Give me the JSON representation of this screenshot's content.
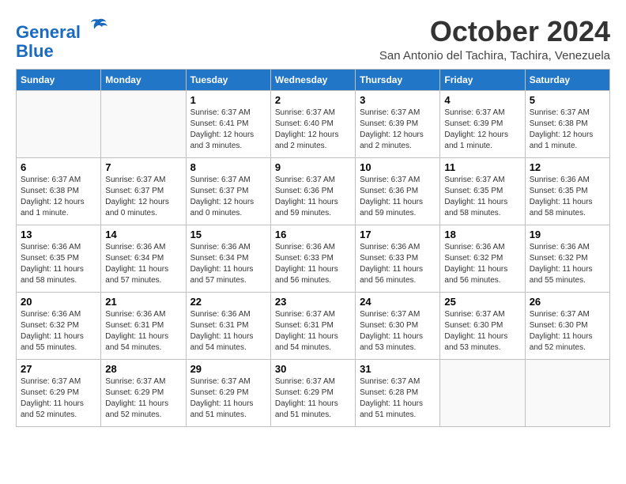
{
  "logo": {
    "line1": "General",
    "line2": "Blue"
  },
  "title": "October 2024",
  "location": "San Antonio del Tachira, Tachira, Venezuela",
  "headers": [
    "Sunday",
    "Monday",
    "Tuesday",
    "Wednesday",
    "Thursday",
    "Friday",
    "Saturday"
  ],
  "weeks": [
    [
      {
        "day": "",
        "content": "",
        "empty": true
      },
      {
        "day": "",
        "content": "",
        "empty": true
      },
      {
        "day": "1",
        "content": "Sunrise: 6:37 AM\nSunset: 6:41 PM\nDaylight: 12 hours\nand 3 minutes."
      },
      {
        "day": "2",
        "content": "Sunrise: 6:37 AM\nSunset: 6:40 PM\nDaylight: 12 hours\nand 2 minutes."
      },
      {
        "day": "3",
        "content": "Sunrise: 6:37 AM\nSunset: 6:39 PM\nDaylight: 12 hours\nand 2 minutes."
      },
      {
        "day": "4",
        "content": "Sunrise: 6:37 AM\nSunset: 6:39 PM\nDaylight: 12 hours\nand 1 minute."
      },
      {
        "day": "5",
        "content": "Sunrise: 6:37 AM\nSunset: 6:38 PM\nDaylight: 12 hours\nand 1 minute."
      }
    ],
    [
      {
        "day": "6",
        "content": "Sunrise: 6:37 AM\nSunset: 6:38 PM\nDaylight: 12 hours\nand 1 minute."
      },
      {
        "day": "7",
        "content": "Sunrise: 6:37 AM\nSunset: 6:37 PM\nDaylight: 12 hours\nand 0 minutes."
      },
      {
        "day": "8",
        "content": "Sunrise: 6:37 AM\nSunset: 6:37 PM\nDaylight: 12 hours\nand 0 minutes."
      },
      {
        "day": "9",
        "content": "Sunrise: 6:37 AM\nSunset: 6:36 PM\nDaylight: 11 hours\nand 59 minutes."
      },
      {
        "day": "10",
        "content": "Sunrise: 6:37 AM\nSunset: 6:36 PM\nDaylight: 11 hours\nand 59 minutes."
      },
      {
        "day": "11",
        "content": "Sunrise: 6:37 AM\nSunset: 6:35 PM\nDaylight: 11 hours\nand 58 minutes."
      },
      {
        "day": "12",
        "content": "Sunrise: 6:36 AM\nSunset: 6:35 PM\nDaylight: 11 hours\nand 58 minutes."
      }
    ],
    [
      {
        "day": "13",
        "content": "Sunrise: 6:36 AM\nSunset: 6:35 PM\nDaylight: 11 hours\nand 58 minutes."
      },
      {
        "day": "14",
        "content": "Sunrise: 6:36 AM\nSunset: 6:34 PM\nDaylight: 11 hours\nand 57 minutes."
      },
      {
        "day": "15",
        "content": "Sunrise: 6:36 AM\nSunset: 6:34 PM\nDaylight: 11 hours\nand 57 minutes."
      },
      {
        "day": "16",
        "content": "Sunrise: 6:36 AM\nSunset: 6:33 PM\nDaylight: 11 hours\nand 56 minutes."
      },
      {
        "day": "17",
        "content": "Sunrise: 6:36 AM\nSunset: 6:33 PM\nDaylight: 11 hours\nand 56 minutes."
      },
      {
        "day": "18",
        "content": "Sunrise: 6:36 AM\nSunset: 6:32 PM\nDaylight: 11 hours\nand 56 minutes."
      },
      {
        "day": "19",
        "content": "Sunrise: 6:36 AM\nSunset: 6:32 PM\nDaylight: 11 hours\nand 55 minutes."
      }
    ],
    [
      {
        "day": "20",
        "content": "Sunrise: 6:36 AM\nSunset: 6:32 PM\nDaylight: 11 hours\nand 55 minutes."
      },
      {
        "day": "21",
        "content": "Sunrise: 6:36 AM\nSunset: 6:31 PM\nDaylight: 11 hours\nand 54 minutes."
      },
      {
        "day": "22",
        "content": "Sunrise: 6:36 AM\nSunset: 6:31 PM\nDaylight: 11 hours\nand 54 minutes."
      },
      {
        "day": "23",
        "content": "Sunrise: 6:37 AM\nSunset: 6:31 PM\nDaylight: 11 hours\nand 54 minutes."
      },
      {
        "day": "24",
        "content": "Sunrise: 6:37 AM\nSunset: 6:30 PM\nDaylight: 11 hours\nand 53 minutes."
      },
      {
        "day": "25",
        "content": "Sunrise: 6:37 AM\nSunset: 6:30 PM\nDaylight: 11 hours\nand 53 minutes."
      },
      {
        "day": "26",
        "content": "Sunrise: 6:37 AM\nSunset: 6:30 PM\nDaylight: 11 hours\nand 52 minutes."
      }
    ],
    [
      {
        "day": "27",
        "content": "Sunrise: 6:37 AM\nSunset: 6:29 PM\nDaylight: 11 hours\nand 52 minutes."
      },
      {
        "day": "28",
        "content": "Sunrise: 6:37 AM\nSunset: 6:29 PM\nDaylight: 11 hours\nand 52 minutes."
      },
      {
        "day": "29",
        "content": "Sunrise: 6:37 AM\nSunset: 6:29 PM\nDaylight: 11 hours\nand 51 minutes."
      },
      {
        "day": "30",
        "content": "Sunrise: 6:37 AM\nSunset: 6:29 PM\nDaylight: 11 hours\nand 51 minutes."
      },
      {
        "day": "31",
        "content": "Sunrise: 6:37 AM\nSunset: 6:28 PM\nDaylight: 11 hours\nand 51 minutes."
      },
      {
        "day": "",
        "content": "",
        "empty": true
      },
      {
        "day": "",
        "content": "",
        "empty": true
      }
    ]
  ]
}
